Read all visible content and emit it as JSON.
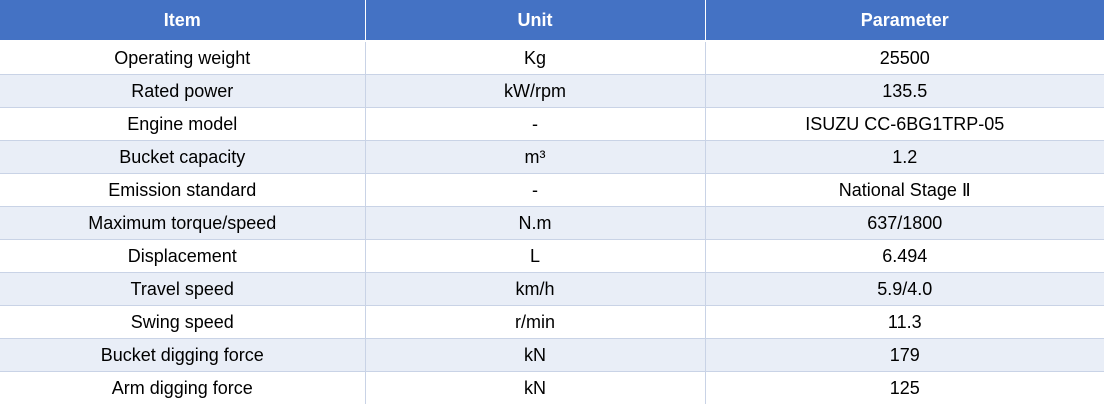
{
  "table": {
    "headers": [
      "Item",
      "Unit",
      "Parameter"
    ],
    "rows": [
      [
        "Operating weight",
        "Kg",
        "25500"
      ],
      [
        "Rated power",
        "kW/rpm",
        "135.5"
      ],
      [
        "Engine model",
        "-",
        "ISUZU CC-6BG1TRP-05"
      ],
      [
        "Bucket capacity",
        "m³",
        "1.2"
      ],
      [
        "Emission standard",
        "-",
        "National Stage Ⅱ"
      ],
      [
        "Maximum torque/speed",
        "N.m",
        "637/1800"
      ],
      [
        "Displacement",
        "L",
        "6.494"
      ],
      [
        "Travel speed",
        "km/h",
        "5.9/4.0"
      ],
      [
        "Swing speed",
        "r/min",
        "11.3"
      ],
      [
        "Bucket digging force",
        "kN",
        "179"
      ],
      [
        "Arm digging force",
        "kN",
        "125"
      ]
    ]
  },
  "colors": {
    "header_bg": "#4472c4",
    "header_text": "#ffffff",
    "row_alt_bg": "#e9eef7",
    "grid": "#c9d3e6"
  }
}
